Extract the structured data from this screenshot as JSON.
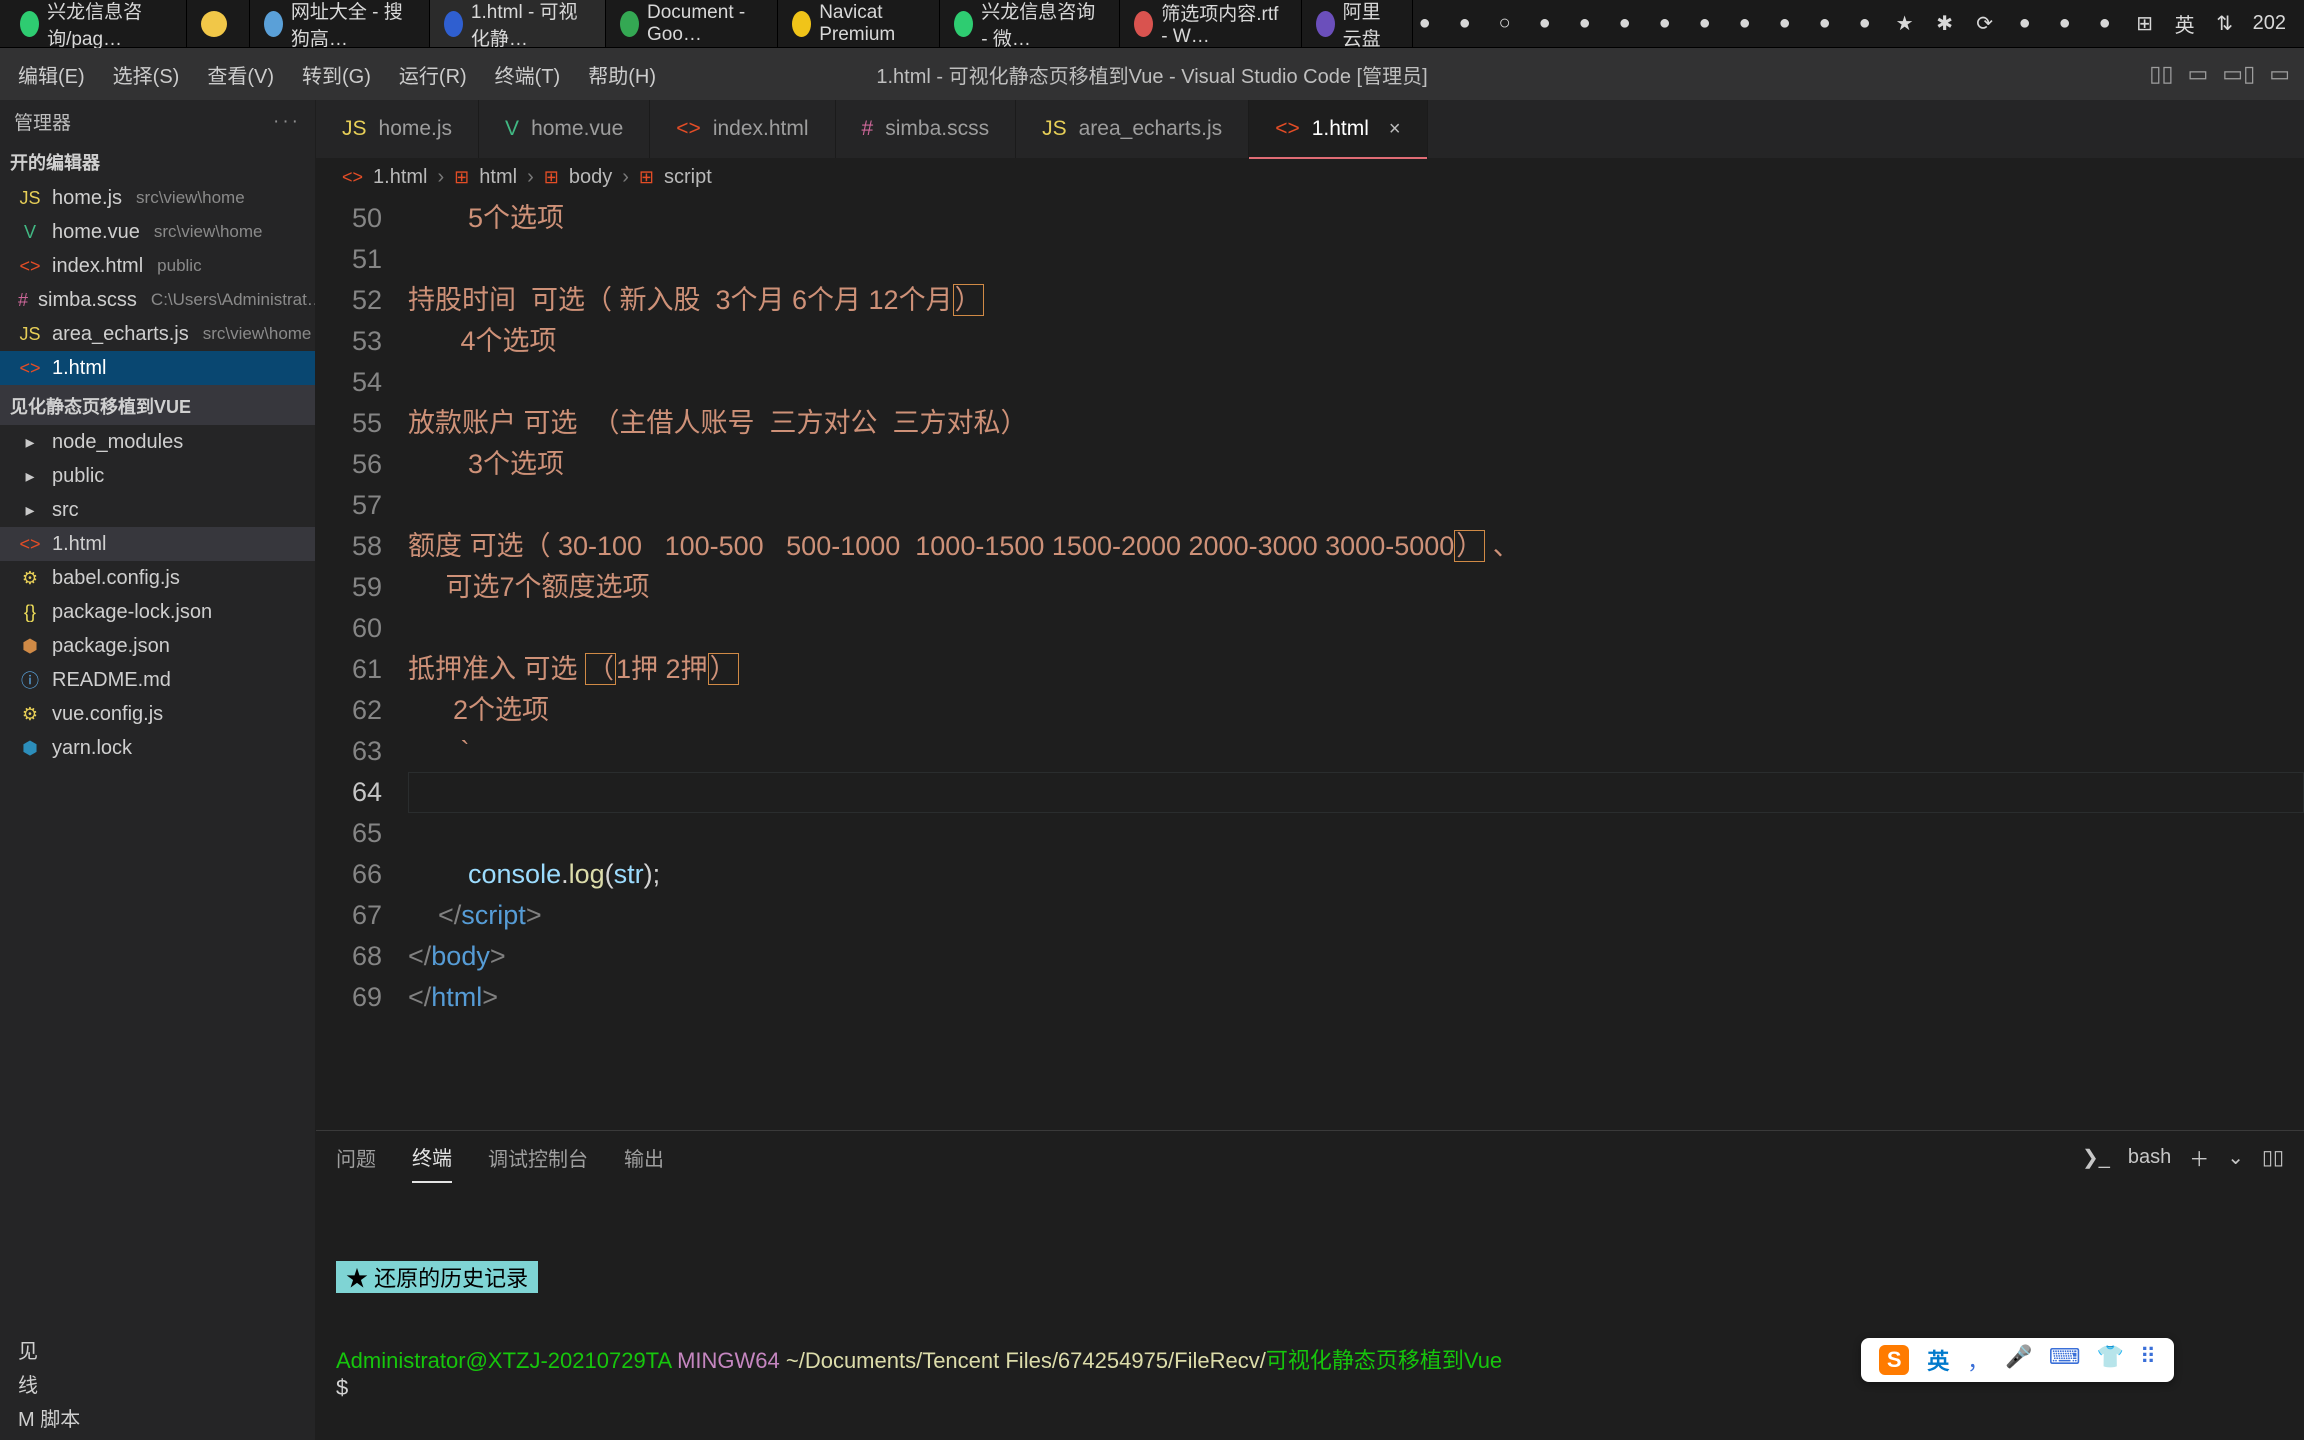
{
  "taskbar": {
    "apps": [
      {
        "label": "兴龙信息咨询/pag…",
        "color": "#2ecc71"
      },
      {
        "label": "",
        "color": "#f1c748"
      },
      {
        "label": "网址大全 - 搜狗高…",
        "color": "#5aa0d8"
      },
      {
        "label": "1.html - 可视化静…",
        "color": "#2f5fd0",
        "active": true
      },
      {
        "label": "Document - Goo…",
        "color": "#34a853"
      },
      {
        "label": "Navicat Premium",
        "color": "#f0c419"
      },
      {
        "label": "兴龙信息咨询 - 微…",
        "color": "#2ecc71"
      },
      {
        "label": "筛选项内容.rtf - W…",
        "color": "#d9534f"
      },
      {
        "label": "阿里云盘",
        "color": "#6b4fbb"
      }
    ],
    "tray_icons": [
      "●",
      "●",
      "○",
      "●",
      "●",
      "●",
      "●",
      "●",
      "●",
      "●",
      "●",
      "●",
      "★",
      "✱",
      "⟳",
      "●",
      "●",
      "●",
      "⊞",
      "英",
      "⇅"
    ],
    "time": "202"
  },
  "menubar": {
    "items": [
      "编辑(E)",
      "选择(S)",
      "查看(V)",
      "转到(G)",
      "运行(R)",
      "终端(T)",
      "帮助(H)"
    ],
    "title": "1.html - 可视化静态页移植到Vue - Visual Studio Code [管理员]",
    "right_icons": [
      "▯▯",
      "▭",
      "▭▯",
      "▭"
    ]
  },
  "sidebar": {
    "title": "管理器",
    "open_editors_title": "开的编辑器",
    "open_editors": [
      {
        "icon": "JS",
        "iconClass": "ic-js",
        "name": "home.js",
        "meta": "src\\view\\home"
      },
      {
        "icon": "V",
        "iconClass": "ic-vue",
        "name": "home.vue",
        "meta": "src\\view\\home"
      },
      {
        "icon": "<>",
        "iconClass": "ic-html",
        "name": "index.html",
        "meta": "public"
      },
      {
        "icon": "#",
        "iconClass": "ic-scss",
        "name": "simba.scss",
        "meta": "C:\\Users\\Administrat…"
      },
      {
        "icon": "JS",
        "iconClass": "ic-js",
        "name": "area_echarts.js",
        "meta": "src\\view\\home"
      },
      {
        "icon": "<>",
        "iconClass": "ic-html",
        "name": "1.html",
        "meta": "",
        "active": true
      }
    ],
    "project_title": "见化静态页移植到VUE",
    "tree": [
      {
        "icon": "▸",
        "iconClass": "ic-folder",
        "name": "node_modules"
      },
      {
        "icon": "▸",
        "iconClass": "ic-folder",
        "name": "public"
      },
      {
        "icon": "▸",
        "iconClass": "ic-folder",
        "name": "src"
      },
      {
        "icon": "<>",
        "iconClass": "ic-html",
        "name": "1.html",
        "selected": true
      },
      {
        "icon": "⚙",
        "iconClass": "ic-js",
        "name": "babel.config.js"
      },
      {
        "icon": "{}",
        "iconClass": "ic-json",
        "name": "package-lock.json"
      },
      {
        "icon": "⬢",
        "iconClass": "ic-pkg",
        "name": "package.json"
      },
      {
        "icon": "ⓘ",
        "iconClass": "ic-md",
        "name": "README.md"
      },
      {
        "icon": "⚙",
        "iconClass": "ic-js",
        "name": "vue.config.js"
      },
      {
        "icon": "⬢",
        "iconClass": "ic-yarn",
        "name": "yarn.lock"
      }
    ],
    "footer_items": [
      "见",
      "线",
      "M 脚本"
    ]
  },
  "tabs": [
    {
      "icon": "JS",
      "iconClass": "ic-js",
      "label": "home.js"
    },
    {
      "icon": "V",
      "iconClass": "ic-vue",
      "label": "home.vue"
    },
    {
      "icon": "<>",
      "iconClass": "ic-html",
      "label": "index.html"
    },
    {
      "icon": "#",
      "iconClass": "ic-scss",
      "label": "simba.scss"
    },
    {
      "icon": "JS",
      "iconClass": "ic-js",
      "label": "area_echarts.js"
    },
    {
      "icon": "<>",
      "iconClass": "ic-html",
      "label": "1.html",
      "active": true,
      "close": true
    }
  ],
  "breadcrumb": [
    "1.html",
    "html",
    "body",
    "script"
  ],
  "code": {
    "start": 50,
    "current": 64,
    "lines": [
      {
        "n": 50,
        "html": "        5个选项"
      },
      {
        "n": 51,
        "html": ""
      },
      {
        "n": 52,
        "html": "持股时间  可选（ 新入股  3个月 6个月 12个月<span class='box'>）</span>  "
      },
      {
        "n": 53,
        "html": "       4个选项"
      },
      {
        "n": 54,
        "html": ""
      },
      {
        "n": 55,
        "html": "放款账户 可选  （主借人账号  三方对公  三方对私）"
      },
      {
        "n": 56,
        "html": "        3个选项"
      },
      {
        "n": 57,
        "html": ""
      },
      {
        "n": 58,
        "html": "额度 可选（ 30-100   100-500   500-1000  1000-1500 1500-2000 2000-3000 3000-5000<span class='box'>）</span> 、"
      },
      {
        "n": 59,
        "html": "     可选7个额度选项"
      },
      {
        "n": 60,
        "html": ""
      },
      {
        "n": 61,
        "html": "抵押准入 可选 <span class='box'>（</span>1押 2押<span class='box'>）</span> "
      },
      {
        "n": 62,
        "html": "      2个选项"
      },
      {
        "n": 63,
        "html": "       `"
      },
      {
        "n": 64,
        "html": "",
        "current": true
      },
      {
        "n": 65,
        "html": ""
      },
      {
        "n": 66,
        "html": "        <span class='obj'>console</span><span class='pun'>.</span><span class='fn'>log</span><span class='pun'>(</span><span class='var'>str</span><span class='pun'>);</span>"
      },
      {
        "n": 67,
        "html": "    <span class='kw'>&lt;/</span><span class='obj' style='color:#569cd6'>script</span><span class='kw'>&gt;</span>"
      },
      {
        "n": 68,
        "html": "<span class='kw'>&lt;/</span><span class='obj' style='color:#569cd6'>body</span><span class='kw'>&gt;</span>"
      },
      {
        "n": 69,
        "html": "<span class='kw'>&lt;/</span><span class='obj' style='color:#569cd6'>html</span><span class='kw'>&gt;</span>"
      }
    ]
  },
  "panel": {
    "tabs": [
      "问题",
      "终端",
      "调试控制台",
      "输出"
    ],
    "active_tab": 1,
    "shell_label": "bash",
    "history_label": " ★  还原的历史记录 ",
    "user": "Administrator@XTZJ-20210729TA",
    "host": " MINGW64 ",
    "path": "~/Documents/Tencent Files/674254975/FileRecv/",
    "path_cn": "可视化静态页移植到Vue",
    "prompt": "$"
  },
  "ime": {
    "logo": "S",
    "lang": "英",
    "icons": [
      "，",
      "🎤",
      "⌨",
      "👕",
      "⠿"
    ]
  }
}
